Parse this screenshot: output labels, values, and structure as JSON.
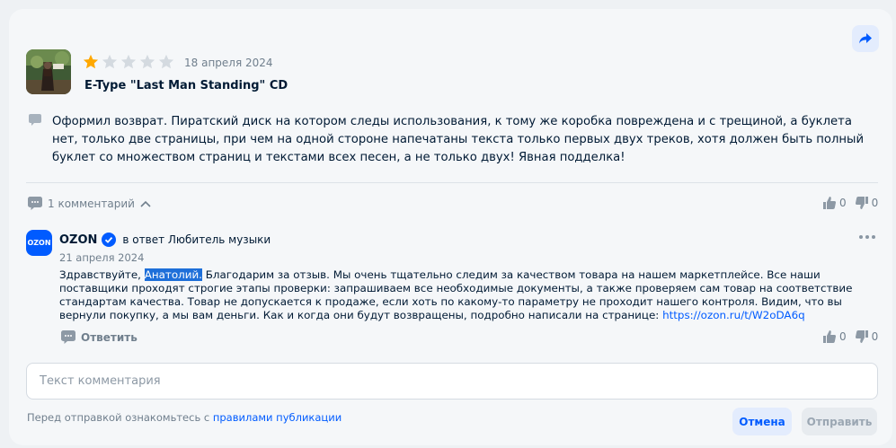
{
  "review": {
    "date": "18 апреля 2024",
    "product_title": "E-Type \"Last Man Standing\" CD",
    "rating": 1,
    "max_rating": 5,
    "text": "Оформил возврат. Пиратский диск на котором следы использования, к тому же коробка повреждена и с трещиной, а буклета нет, только две страницы, при чем на одной стороне напечатаны текста только первых двух треков, хотя должен быть полный буклет со множеством страниц и текстами всех песен, а не только двух! Явная подделка!",
    "comments_label": "1 комментарий",
    "likes": "0",
    "dislikes": "0"
  },
  "reply": {
    "logo_text": "OZON",
    "seller_name": "OZON",
    "reply_to": "в ответ Любитель музыки",
    "date": "21 апреля 2024",
    "text_before": "Здравствуйте, ",
    "highlight": "Анатолий.",
    "text_after": " Благодарим за отзыв. Мы очень тщательно следим за качеством товара на нашем маркетплейсе. Все наши поставщики проходят строгие этапы проверки: запрашиваем все необходимые документы, а также проверяем сам товар на соответствие стандартам качества. Товар не допускается к продаже, если хоть по какому-то параметру не проходит нашего контроля. Видим, что вы вернули покупку, а мы вам деньги. Как и когда они будут возвращены, подробно написали на странице: ",
    "link": "https://ozon.ru/t/W2oDA6q",
    "answer_label": "Ответить",
    "likes": "0",
    "dislikes": "0"
  },
  "comment_form": {
    "placeholder": "Текст комментария",
    "rules_prefix": "Перед отправкой ознакомьтесь с ",
    "rules_link": "правилами публикации",
    "cancel_label": "Отмена",
    "send_label": "Отправить"
  },
  "colors": {
    "accent": "#005bff",
    "star_filled": "#ffa800",
    "star_empty": "#d4dae0"
  },
  "icons": [
    "share-icon",
    "star-icon",
    "comment-bubble-icon",
    "chevron-up-icon",
    "thumbs-up-icon",
    "thumbs-down-icon",
    "verified-badge-icon",
    "more-dots-icon"
  ]
}
